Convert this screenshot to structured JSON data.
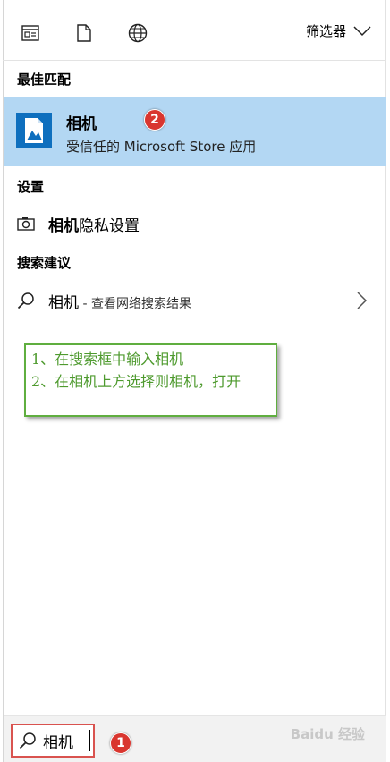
{
  "toolbar": {
    "icons": [
      "apps-icon",
      "document-icon",
      "web-icon"
    ],
    "filter_label": "筛选器"
  },
  "sections": {
    "best_match": "最佳匹配",
    "settings": "设置",
    "suggestions": "搜索建议"
  },
  "best_match": {
    "app_name": "相机",
    "app_subtitle": "受信任的 Microsoft Store 应用",
    "badge": "2"
  },
  "settings_item": {
    "bold": "相机",
    "rest": "隐私设置"
  },
  "suggestion_item": {
    "term": "相机",
    "rest": " - 查看网络搜索结果"
  },
  "annotation": {
    "line1": "1、在搜索框中输入相机",
    "line2": "2、在相机上方选择则相机，打开"
  },
  "search": {
    "value": "相机",
    "badge": "1"
  },
  "watermark": "Baidu 经验",
  "colors": {
    "highlight": "#b3d7f3",
    "badge": "#d9362f",
    "annotation_border": "#5fae3f",
    "annotation_text": "#4e9a2e",
    "search_outline": "#d9534f"
  }
}
